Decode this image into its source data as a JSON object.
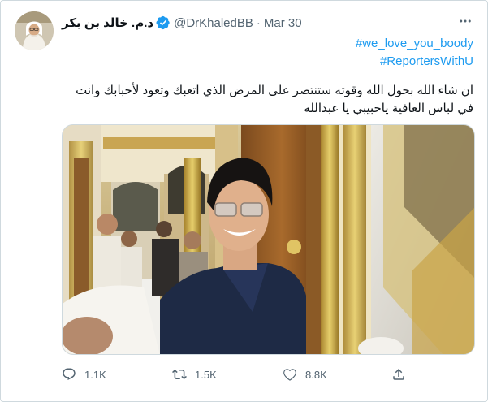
{
  "tweet": {
    "author_name": "د.م. خالد بن بكر",
    "author_handle": "@DrKhaledBB",
    "separator": "·",
    "timestamp": "Mar 30",
    "hashtags": [
      "#we_love_you_boody",
      "#ReportersWithU"
    ],
    "text_line1": "ان شاء الله بحول الله وقوته ستنتصر على المرض الذي اتعبك وتعود لأحبابك وانت",
    "text_line2": "في لباس العافية ياحبيبي يا عبدالله"
  },
  "actions": {
    "reply_count": "1.1K",
    "retweet_count": "1.5K",
    "like_count": "8.8K"
  },
  "icons": {
    "verified": "verified-badge-icon",
    "more": "more-options-icon",
    "reply": "reply-icon",
    "retweet": "retweet-icon",
    "like": "heart-icon",
    "share": "share-icon"
  },
  "colors": {
    "link": "#1d9bf0",
    "secondary_text": "#536471",
    "primary_text": "#0f1419",
    "border": "#cfd9de"
  }
}
